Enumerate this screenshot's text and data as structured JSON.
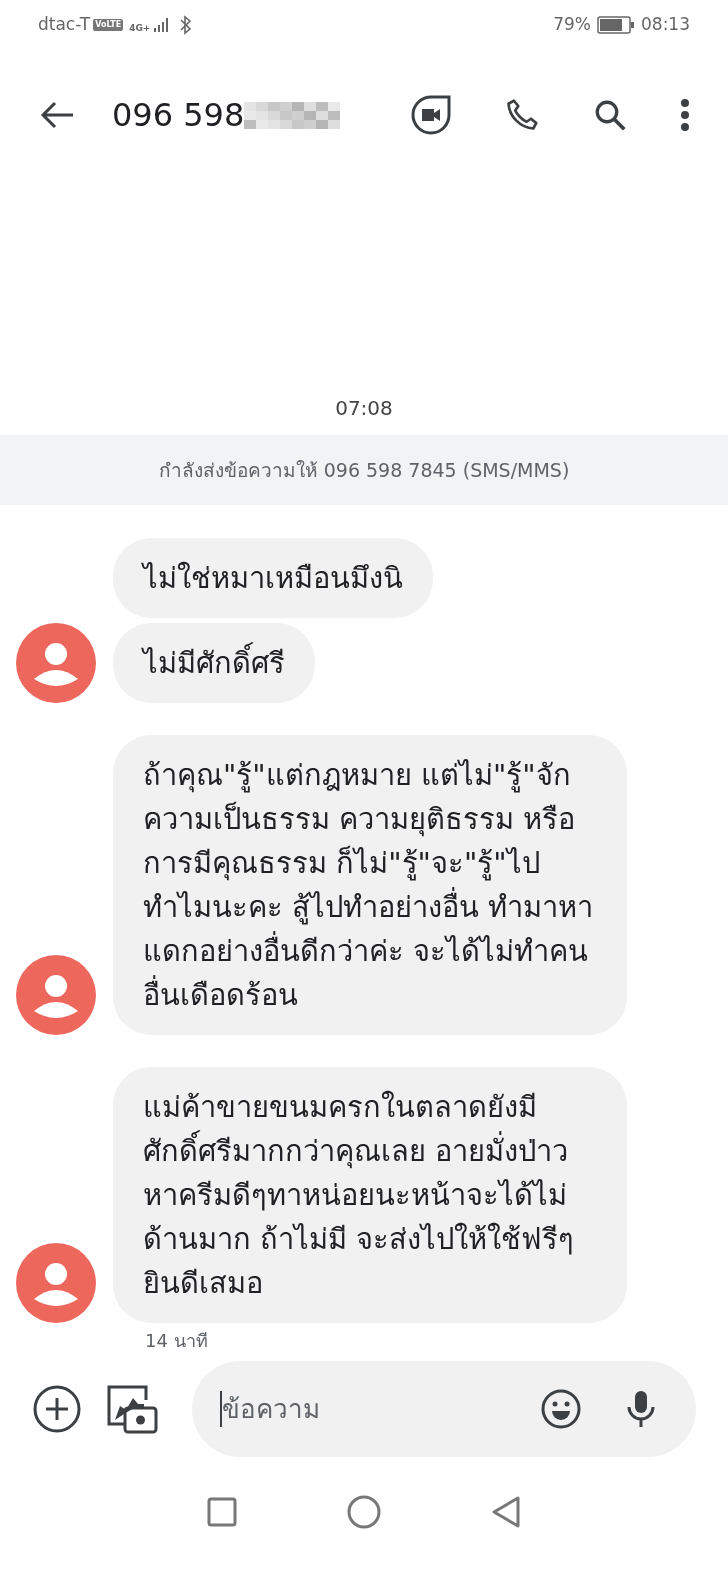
{
  "status_bar": {
    "carrier": "dtac-T",
    "volte": "VoLTE",
    "network": "4G+",
    "battery": "79%",
    "time": "08:13"
  },
  "header": {
    "title": "096 598"
  },
  "conversation": {
    "timestamp": "07:08",
    "banner": "กำลังส่งข้อความให้ 096 598 7845 (SMS/MMS)",
    "groups": [
      {
        "messages": [
          "ไม่ใช่หมาเหมือนมึงนิ",
          "ไม่มีศักดิ์ศรี"
        ]
      },
      {
        "messages": [
          "ถ้าคุณ\"รู้\"แต่กฎหมาย แต่ไม่\"รู้\"จักความเป็นธรรม ความยุติธรรม หรือการมีคุณธรรม ก็ไม่\"รู้\"จะ\"รู้\"ไปทำไมนะคะ สู้ไปทำอย่างอื่น ทำมาหาแดกอย่างอื่นดีกว่าค่ะ จะได้ไม่ทำคนอื่นเดือดร้อน"
        ]
      },
      {
        "messages": [
          "แม่ค้าขายขนมครกในตลาดยังมีศักดิ์ศรีมากกว่าคุณเลย อายมั่งป่าว หาครีมดีๆทาหน่อยนะหน้าจะได้ไม่ด้านมาก ถ้าไม่มี จะส่งไปให้ใช้ฟรีๆ ยินดีเสมอ"
        ]
      }
    ],
    "elapsed": "14 นาที"
  },
  "composer": {
    "placeholder": "ข้อความ"
  }
}
